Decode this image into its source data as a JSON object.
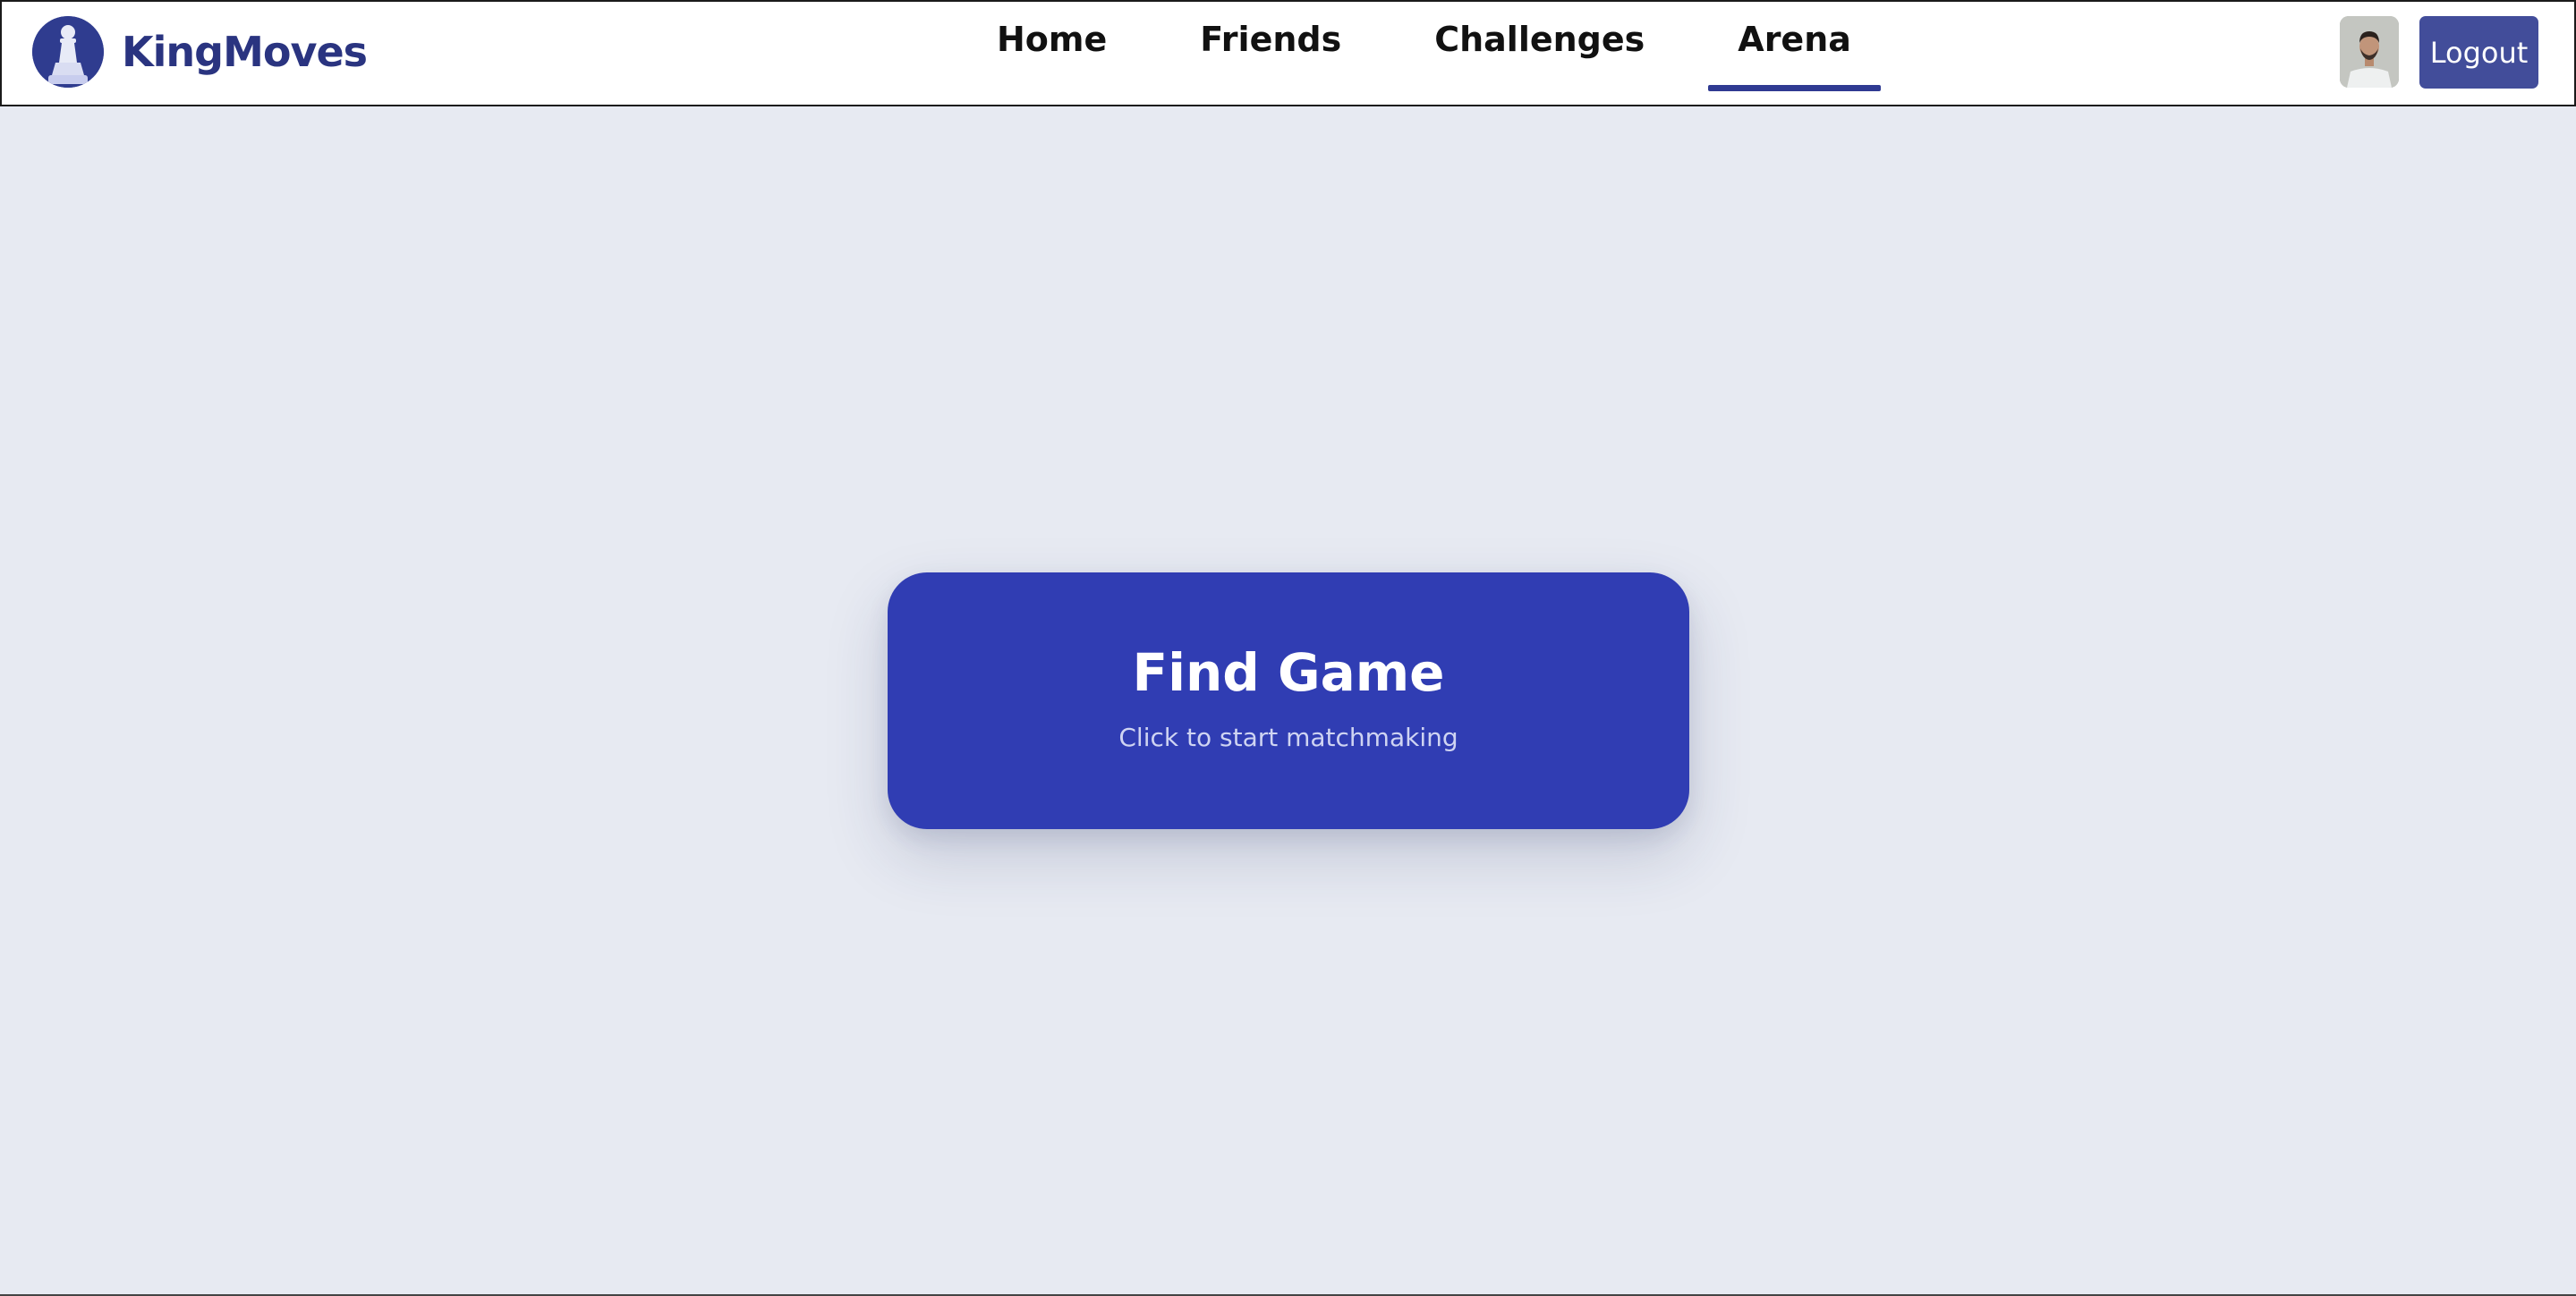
{
  "brand": {
    "name": "KingMoves",
    "logo_icon": "chess-pawn-icon"
  },
  "nav": {
    "links": [
      {
        "label": "Home",
        "active": false
      },
      {
        "label": "Friends",
        "active": false
      },
      {
        "label": "Challenges",
        "active": false
      },
      {
        "label": "Arena",
        "active": true
      }
    ]
  },
  "user": {
    "avatar_icon": "user-avatar",
    "logout_label": "Logout"
  },
  "main": {
    "find_game": {
      "title": "Find Game",
      "subtitle": "Click to start matchmaking"
    }
  },
  "colors": {
    "background": "#e7eaf2",
    "brand": "#2a3480",
    "accent": "#303db3",
    "logout": "#424d9a"
  }
}
